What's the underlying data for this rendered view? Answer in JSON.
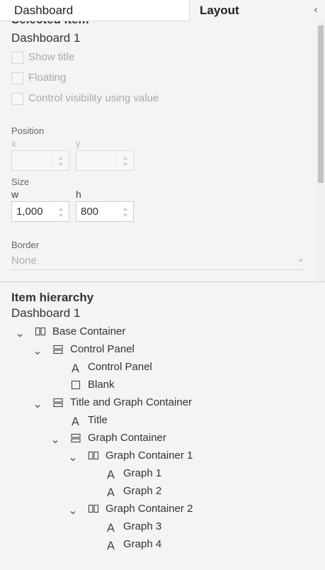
{
  "tabs": {
    "dashboard": "Dashboard",
    "layout": "Layout",
    "collapse_glyph": "‹"
  },
  "selected_item": {
    "heading": "Selected item",
    "name": "Dashboard 1",
    "checkboxes": [
      {
        "label": "Show title",
        "checked": false,
        "enabled": false
      },
      {
        "label": "Floating",
        "checked": false,
        "enabled": false
      },
      {
        "label": "Control visibility using value",
        "checked": false,
        "enabled": false
      }
    ],
    "position": {
      "label": "Position",
      "x_label": "x",
      "y_label": "y",
      "x_value": "",
      "y_value": ""
    },
    "size": {
      "label": "Size",
      "w_label": "w",
      "h_label": "h",
      "w_value": "1,000",
      "h_value": "800"
    },
    "border": {
      "label": "Border",
      "value": "None"
    }
  },
  "hierarchy": {
    "title": "Item hierarchy",
    "dashboard": "Dashboard 1",
    "items": [
      {
        "label": "Base Container",
        "icon": "horizontal-container-icon",
        "expanded": true
      },
      {
        "label": "Control Panel",
        "icon": "vertical-container-icon",
        "expanded": true
      },
      {
        "label": "Control Panel",
        "icon": "text-icon"
      },
      {
        "label": "Blank",
        "icon": "blank-icon"
      },
      {
        "label": "Title and Graph Container",
        "icon": "vertical-container-icon",
        "expanded": true
      },
      {
        "label": "Title",
        "icon": "text-icon"
      },
      {
        "label": "Graph Container",
        "icon": "vertical-container-icon",
        "expanded": true
      },
      {
        "label": "Graph Container 1",
        "icon": "horizontal-container-icon",
        "expanded": true
      },
      {
        "label": "Graph 1",
        "icon": "text-icon"
      },
      {
        "label": "Graph 2",
        "icon": "text-icon"
      },
      {
        "label": "Graph Container 2",
        "icon": "horizontal-container-icon",
        "expanded": true
      },
      {
        "label": "Graph 3",
        "icon": "text-icon"
      },
      {
        "label": "Graph 4",
        "icon": "text-icon"
      }
    ],
    "text_icon_glyph": "A"
  }
}
